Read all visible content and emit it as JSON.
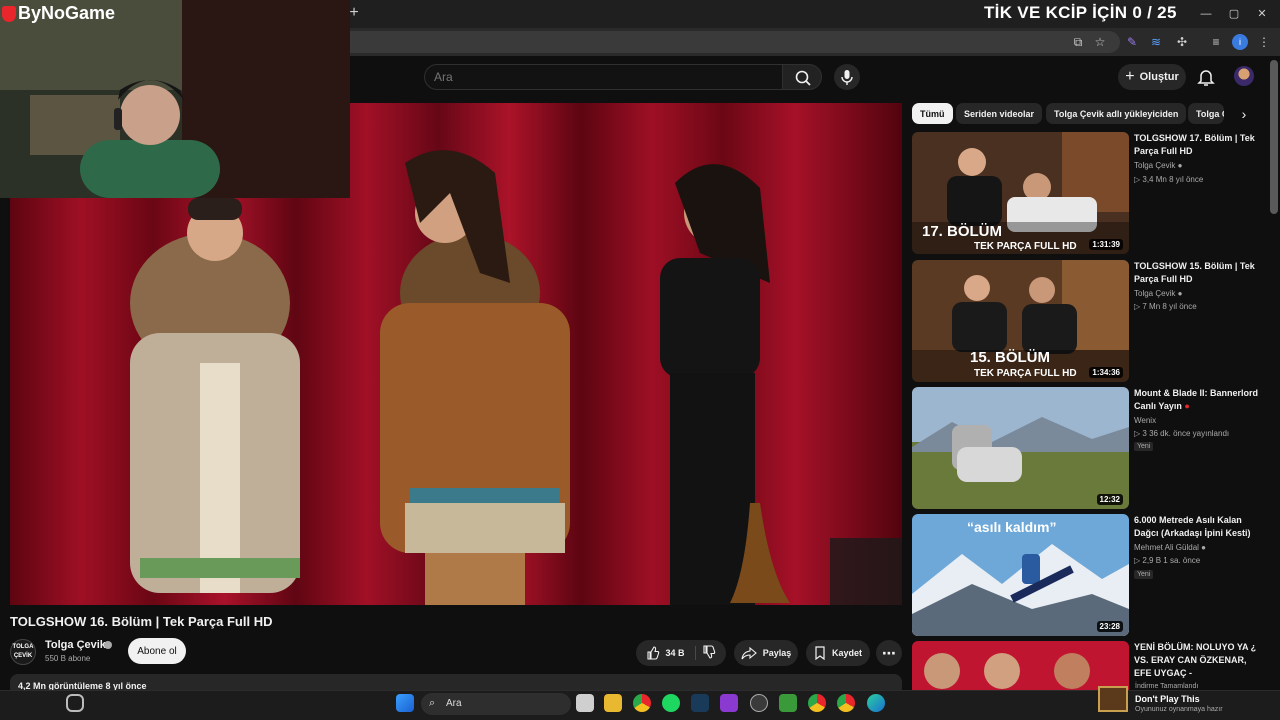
{
  "overlay": {
    "logo_text": "ByNoGame",
    "tik_title": "TİK VE KCİP İÇİN 0 / 25"
  },
  "browser": {
    "new_tab_icon": "plus-icon",
    "window_controls": [
      "minimize-icon",
      "maximize-icon",
      "close-icon"
    ]
  },
  "youtube_header": {
    "search_placeholder": "Ara",
    "create_label": "Oluştur"
  },
  "video": {
    "title": "TOLGSHOW 16. Bölüm | Tek Parça Full HD",
    "channel": {
      "name": "Tolga Çevik",
      "avatar_text": "TOLGA ÇEVİK",
      "subscribers": "550 B abone",
      "verified": true
    },
    "subscribe_label": "Abone ol",
    "likes": "34 B",
    "share_label": "Paylaş",
    "save_label": "Kaydet",
    "views_line": "4,2 Mn görüntüleme  8 yıl önce"
  },
  "chips": [
    "Tümü",
    "Seriden videolar",
    "Tolga Çevik adlı yükleyiciden",
    "Tolga Ç"
  ],
  "recommendations": [
    {
      "title": "TOLGSHOW 17. Bölüm | Tek Parça Full HD",
      "channel": "Tolga Çevik",
      "verified": true,
      "views": "3,4 Mn",
      "age": "8 yıl önce",
      "duration": "1:31:39",
      "overlay_text": [
        "17. BÖLÜM",
        "TEK PARÇA FULL HD"
      ]
    },
    {
      "title": "TOLGSHOW 15. Bölüm | Tek Parça Full HD",
      "channel": "Tolga Çevik",
      "verified": true,
      "views": "7 Mn",
      "age": "8 yıl önce",
      "duration": "1:34:36",
      "overlay_text": [
        "15. BÖLÜM",
        "TEK PARÇA FULL HD"
      ]
    },
    {
      "title": "Mount & Blade II: Bannerlord Canlı Yayın",
      "channel": "Wenix",
      "views": "3",
      "age": "36 dk. önce yayınlandı",
      "badge": "Yeni",
      "duration": "12:32"
    },
    {
      "title": "6.000 Metrede Asılı Kalan Dağcı (Arkadaşı İpini Kesti)",
      "channel": "Mehmet Ali Güldal",
      "verified": true,
      "views": "2,9 B",
      "age": "1 sa. önce",
      "badge": "Yeni",
      "duration": "23:28",
      "overlay_text": [
        "“asılı kaldım”"
      ]
    },
    {
      "title": "YENİ BÖLÜM: NOLUYO YA ¿ VS. ERAY CAN ÖZKENAR, EFE UYGAÇ -",
      "channel": "",
      "views": "",
      "age": ""
    }
  ],
  "taskbar": {
    "search_label": "Ara",
    "notification": {
      "title": "İndirme Tamamlandı",
      "main": "Don't Play This",
      "sub": "Oyununuz oynanmaya hazır"
    }
  },
  "colors": {
    "accent_red": "#e8262b",
    "yt_dark": "#0f0f0f",
    "pill": "#272727"
  }
}
